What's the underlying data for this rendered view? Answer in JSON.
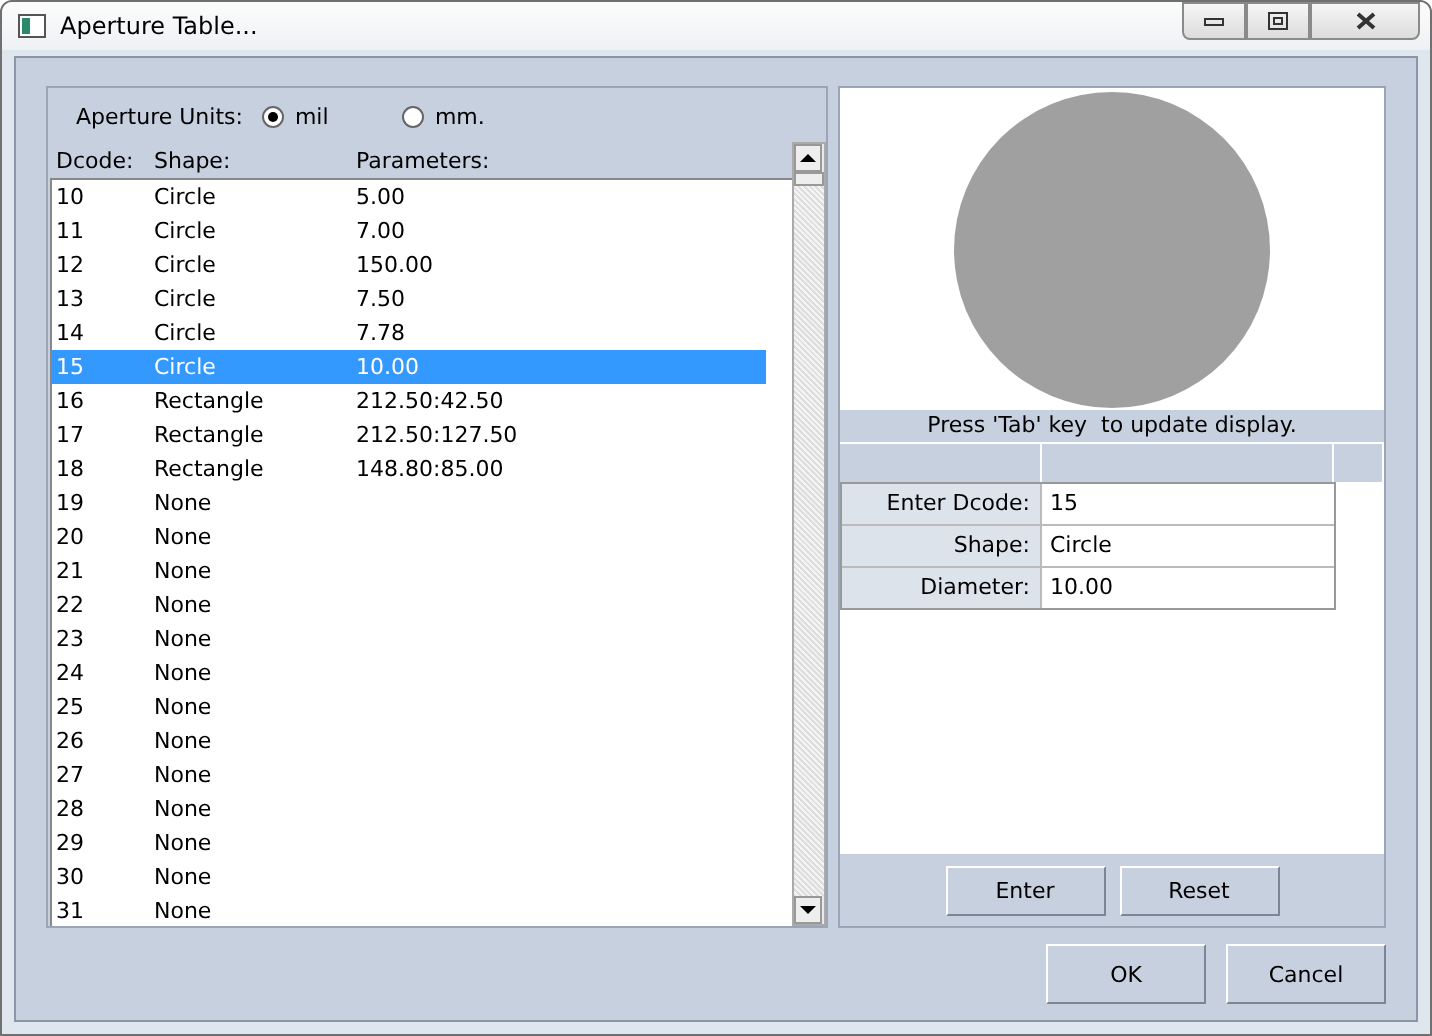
{
  "window": {
    "title": "Aperture Table..."
  },
  "units": {
    "label": "Aperture Units:",
    "options": [
      {
        "label": "mil",
        "selected": true
      },
      {
        "label": "mm.",
        "selected": false
      }
    ]
  },
  "table": {
    "columns": [
      "Dcode:",
      "Shape:",
      "Parameters:"
    ],
    "rows": [
      {
        "dcode": "10",
        "shape": "Circle",
        "params": "5.00",
        "selected": false
      },
      {
        "dcode": "11",
        "shape": "Circle",
        "params": "7.00",
        "selected": false
      },
      {
        "dcode": "12",
        "shape": "Circle",
        "params": "150.00",
        "selected": false
      },
      {
        "dcode": "13",
        "shape": "Circle",
        "params": "7.50",
        "selected": false
      },
      {
        "dcode": "14",
        "shape": "Circle",
        "params": "7.78",
        "selected": false
      },
      {
        "dcode": "15",
        "shape": "Circle",
        "params": "10.00",
        "selected": true
      },
      {
        "dcode": "16",
        "shape": "Rectangle",
        "params": "212.50:42.50",
        "selected": false
      },
      {
        "dcode": "17",
        "shape": "Rectangle",
        "params": "212.50:127.50",
        "selected": false
      },
      {
        "dcode": "18",
        "shape": "Rectangle",
        "params": "148.80:85.00",
        "selected": false
      },
      {
        "dcode": "19",
        "shape": "None",
        "selected": false
      },
      {
        "dcode": "20",
        "shape": "None",
        "selected": false
      },
      {
        "dcode": "21",
        "shape": "None",
        "selected": false
      },
      {
        "dcode": "22",
        "shape": "None",
        "selected": false
      },
      {
        "dcode": "23",
        "shape": "None",
        "selected": false
      },
      {
        "dcode": "24",
        "shape": "None",
        "selected": false
      },
      {
        "dcode": "25",
        "shape": "None",
        "selected": false
      },
      {
        "dcode": "26",
        "shape": "None",
        "selected": false
      },
      {
        "dcode": "27",
        "shape": "None",
        "selected": false
      },
      {
        "dcode": "28",
        "shape": "None",
        "selected": false
      },
      {
        "dcode": "29",
        "shape": "None",
        "selected": false
      },
      {
        "dcode": "30",
        "shape": "None",
        "selected": false
      },
      {
        "dcode": "31",
        "shape": "None",
        "selected": false
      }
    ]
  },
  "preview": {
    "kind": "circle",
    "hint": "Press 'Tab' key  to update display.",
    "fields": [
      {
        "label": "Enter Dcode:",
        "value": "15"
      },
      {
        "label": "Shape:",
        "value": "Circle"
      },
      {
        "label": "Diameter:",
        "value": "10.00"
      }
    ],
    "buttons": [
      "Enter",
      "Reset"
    ]
  },
  "buttons": [
    "OK",
    "Cancel"
  ]
}
